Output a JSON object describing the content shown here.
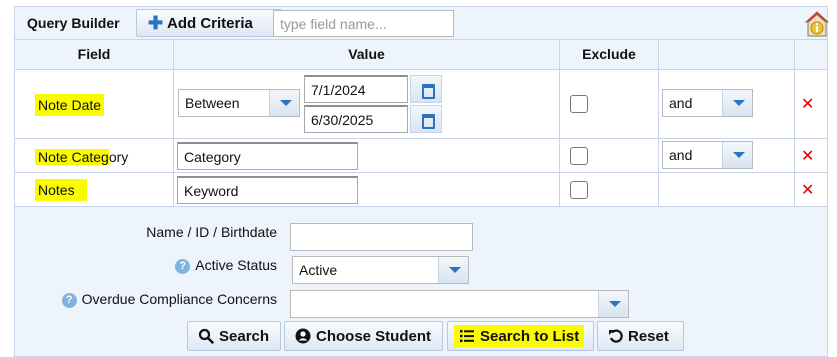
{
  "toolbar": {
    "title": "Query Builder",
    "add_criteria_label": "Add Criteria",
    "field_search_placeholder": "type field name..."
  },
  "grid": {
    "headers": {
      "field": "Field",
      "value": "Value",
      "exclude": "Exclude",
      "actions": ""
    },
    "rows": [
      {
        "field": "Note Date",
        "operator": "Between",
        "date_from": "7/1/2024",
        "date_to": "6/30/2025",
        "exclude": false,
        "conjunction": "and",
        "highlighted": "full"
      },
      {
        "field_highlighted_part": "Note Categ",
        "field_rest": "ory",
        "value": "Category",
        "exclude": false,
        "conjunction": "and"
      },
      {
        "field": "Notes",
        "value": "Keyword",
        "exclude": false
      }
    ],
    "remove_symbol": "✕"
  },
  "search_form": {
    "name_label": "Name / ID / Birthdate",
    "name_value": "",
    "active_status_label": "Active Status",
    "active_status_value": "Active",
    "overdue_label": "Overdue Compliance Concerns",
    "overdue_value": "",
    "help_glyph": "?"
  },
  "buttons": {
    "search": "Search",
    "choose_student": "Choose Student",
    "search_to_list": "Search to List",
    "reset": "Reset"
  },
  "colors": {
    "panel_bg": "#eef4fb",
    "border": "#c6d6e8",
    "accent": "#2a72c2",
    "highlight": "#fafa00",
    "remove": "#e00000"
  },
  "icons": [
    "plus-icon",
    "help-info-icon",
    "calendar-icon",
    "chevron-down-icon",
    "close-icon",
    "search-icon",
    "user-icon",
    "list-icon",
    "undo-icon",
    "question-icon"
  ]
}
